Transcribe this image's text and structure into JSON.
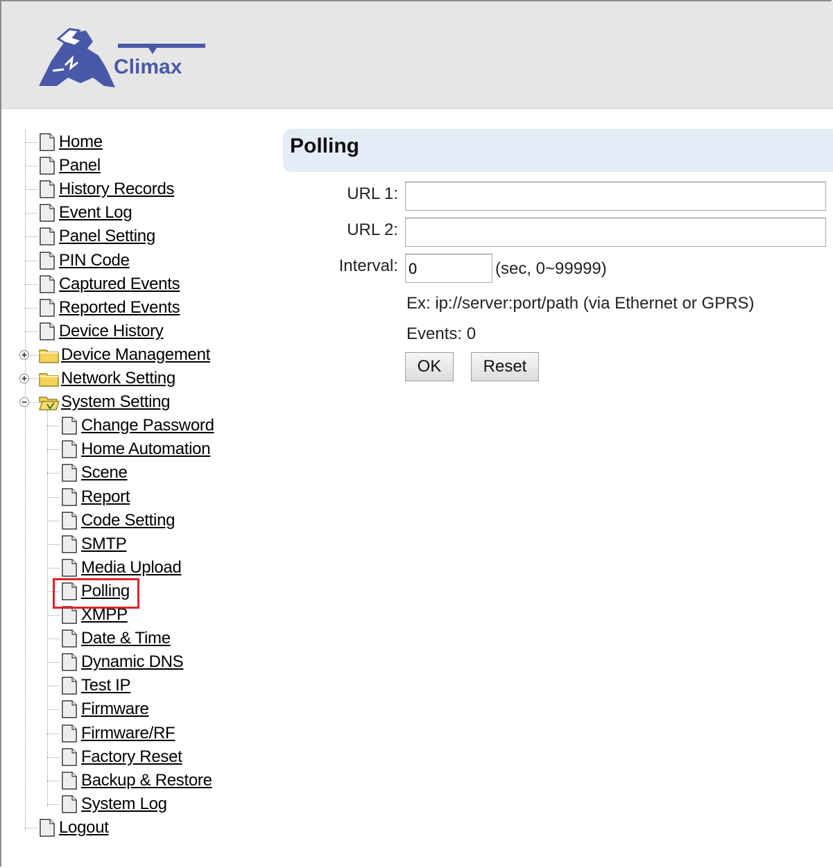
{
  "header": {
    "logo_text": "Climax"
  },
  "tree": {
    "items": [
      {
        "label": "Home",
        "type": "page"
      },
      {
        "label": "Panel",
        "type": "page"
      },
      {
        "label": "History Records",
        "type": "page"
      },
      {
        "label": "Event Log",
        "type": "page"
      },
      {
        "label": "Panel Setting",
        "type": "page"
      },
      {
        "label": "PIN Code",
        "type": "page"
      },
      {
        "label": "Captured Events",
        "type": "page"
      },
      {
        "label": "Reported Events",
        "type": "page"
      },
      {
        "label": "Device History",
        "type": "page"
      },
      {
        "label": "Device Management",
        "type": "folder",
        "expanded": false
      },
      {
        "label": "Network Setting",
        "type": "folder",
        "expanded": false
      },
      {
        "label": "System Setting",
        "type": "folder",
        "expanded": true
      },
      {
        "label": "Logout",
        "type": "page"
      }
    ],
    "system_children": [
      {
        "label": "Change Password"
      },
      {
        "label": "Home Automation"
      },
      {
        "label": "Scene"
      },
      {
        "label": "Report"
      },
      {
        "label": "Code Setting"
      },
      {
        "label": "SMTP"
      },
      {
        "label": "Media Upload"
      },
      {
        "label": "Polling",
        "selected": true
      },
      {
        "label": "XMPP"
      },
      {
        "label": "Date & Time"
      },
      {
        "label": "Dynamic DNS"
      },
      {
        "label": "Test IP"
      },
      {
        "label": "Firmware"
      },
      {
        "label": "Firmware/RF"
      },
      {
        "label": "Factory Reset"
      },
      {
        "label": "Backup & Restore"
      },
      {
        "label": "System Log"
      }
    ]
  },
  "main": {
    "title": "Polling",
    "url1_label": "URL 1:",
    "url1_value": "",
    "url2_label": "URL 2:",
    "url2_value": "",
    "interval_label": "Interval:",
    "interval_value": "0",
    "interval_hint": "(sec, 0~99999)",
    "example": "Ex: ip://server:port/path (via Ethernet or GPRS)",
    "events": "Events: 0",
    "ok_label": "OK",
    "reset_label": "Reset"
  },
  "colors": {
    "title_bar": "#e4ecf8",
    "highlight": "#e0202a",
    "logo": "#4a58a8",
    "folder": "#f5d35a"
  }
}
